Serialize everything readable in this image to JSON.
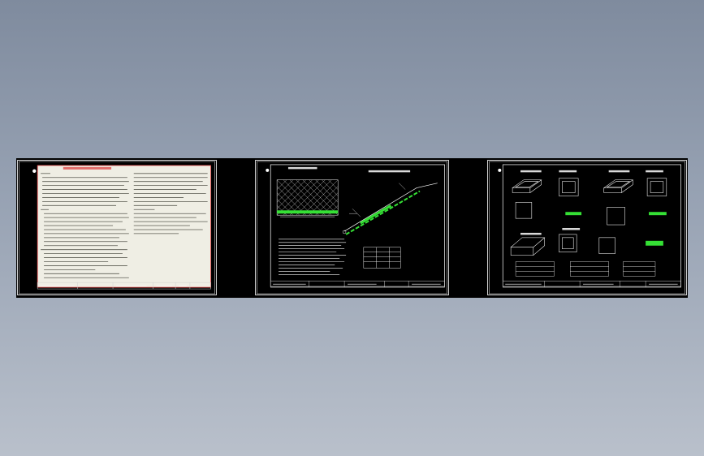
{
  "viewer": {
    "background_top": "#7f8b9e",
    "background_bottom": "#b9c0cb"
  },
  "sheets": [
    {
      "id": "sheet-1",
      "kind": "notes",
      "paper_color": "#efeee4",
      "border_color": "#e04040"
    },
    {
      "id": "sheet-2",
      "kind": "slope-section",
      "accent_color": "#35e035"
    },
    {
      "id": "sheet-3",
      "kind": "box-details",
      "accent_color": "#35e035"
    }
  ]
}
